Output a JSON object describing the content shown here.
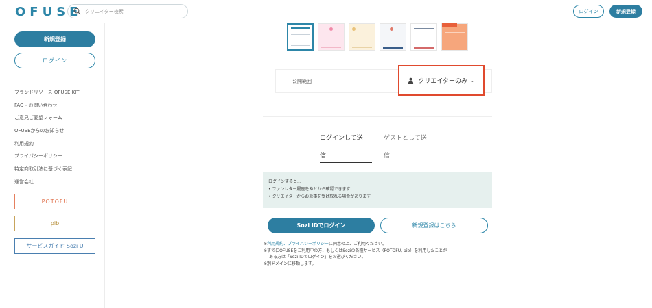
{
  "header": {
    "logo": "OFUSE",
    "search_placeholder": "クリエイター検索",
    "login_label": "ログイン",
    "signup_label": "新規登録"
  },
  "sidebar": {
    "signup_label": "新規登録",
    "login_label": "ログイン",
    "links": [
      "ブランドリソース OFUSE KIT",
      "FAQ・お問い合わせ",
      "ご意見ご要望フォーム",
      "OFUSEからのお知らせ",
      "利用規約",
      "プライバシーポリシー",
      "特定商取引法に基づく表記",
      "運営会社"
    ],
    "services": {
      "potofu": "POTOFU",
      "pib": "pib",
      "sozi": "サービスガイド Sozi U"
    }
  },
  "main": {
    "scope_label": "公開範囲",
    "scope_value": "クリエイターのみ",
    "tabs": {
      "login_line1": "ログインして送",
      "login_line2": "信",
      "guest_line1": "ゲストとして送",
      "guest_line2": "信"
    },
    "info": {
      "title": "ログインすると...",
      "bullet1": "• ファンレター履歴をあとから確認できます",
      "bullet2": "• クリエイターからお返事を受け取れる場合があります"
    },
    "sozi_login_label": "Sozi IDでログイン",
    "new_signup_label": "新規登録はこちら",
    "notes": {
      "line1_prefix": "※",
      "line1_link1": "利用規約",
      "line1_sep": "、",
      "line1_link2": "プライバシーポリシー",
      "line1_suffix": "に同意の上、ご利用ください。",
      "line2": "※すでにOFUSEをご利用中の方、もしくはSoziの各種サービス（POTOFU, pib）を利用したことが",
      "line3": "ある方は「Sozi IDでログイン」をお選びください。",
      "line4": "※別ドメインに移動します。"
    }
  },
  "colors": {
    "accent": "#2d7ea1",
    "highlight_border": "#e04a2e",
    "potofu": "#e0704b",
    "pib": "#b8913d",
    "sozi": "#4a7fb0"
  }
}
